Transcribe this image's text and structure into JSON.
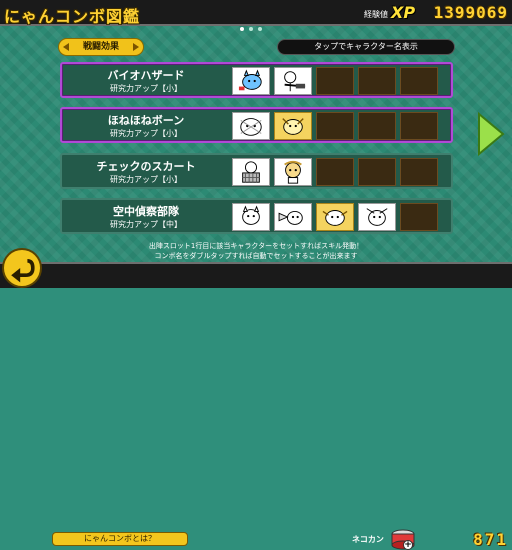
{
  "header": {
    "title": "にゃんコンボ図鑑",
    "xp_label": "経験値",
    "xp_tag": "XP",
    "xp_value": "1399069"
  },
  "pager": {
    "pages": 3,
    "current": 0
  },
  "controls": {
    "effect_pill": "戦闘効果",
    "tap_hint": "タップでキャラクター名表示"
  },
  "combos": [
    {
      "name": "バイオハザード",
      "effect": "研究力アップ【小】",
      "slots": [
        "cat-a",
        "cat-b",
        "empty",
        "empty",
        "empty"
      ]
    },
    {
      "name": "ほねほねボーン",
      "effect": "研究力アップ【小】",
      "slots": [
        "cat-c",
        "cat-gold",
        "empty",
        "empty",
        "empty"
      ]
    },
    {
      "name": "チェックのスカート",
      "effect": "研究力アップ【小】",
      "slots": [
        "cat-d",
        "cat-e",
        "empty",
        "empty",
        "empty"
      ]
    },
    {
      "name": "空中偵察部隊",
      "effect": "研究力アップ【中】",
      "slots": [
        "cat-f",
        "cat-g",
        "cat-gold",
        "cat-h",
        "empty"
      ]
    }
  ],
  "footer": {
    "info_line1": "出陣スロット1行目に該当キャラクターをセットすればスキル発動！",
    "info_line2": "コンボ名をダブルタップすれば自動でセットすることが出来ます",
    "help_label": "にゃんコンボとは？",
    "nekokan_label": "ネコカン",
    "nekokan_value": "871",
    "colors": {
      "accent": "#f3c61d",
      "selected_border": "#b04ad6",
      "teal": "#2c8a74"
    }
  }
}
